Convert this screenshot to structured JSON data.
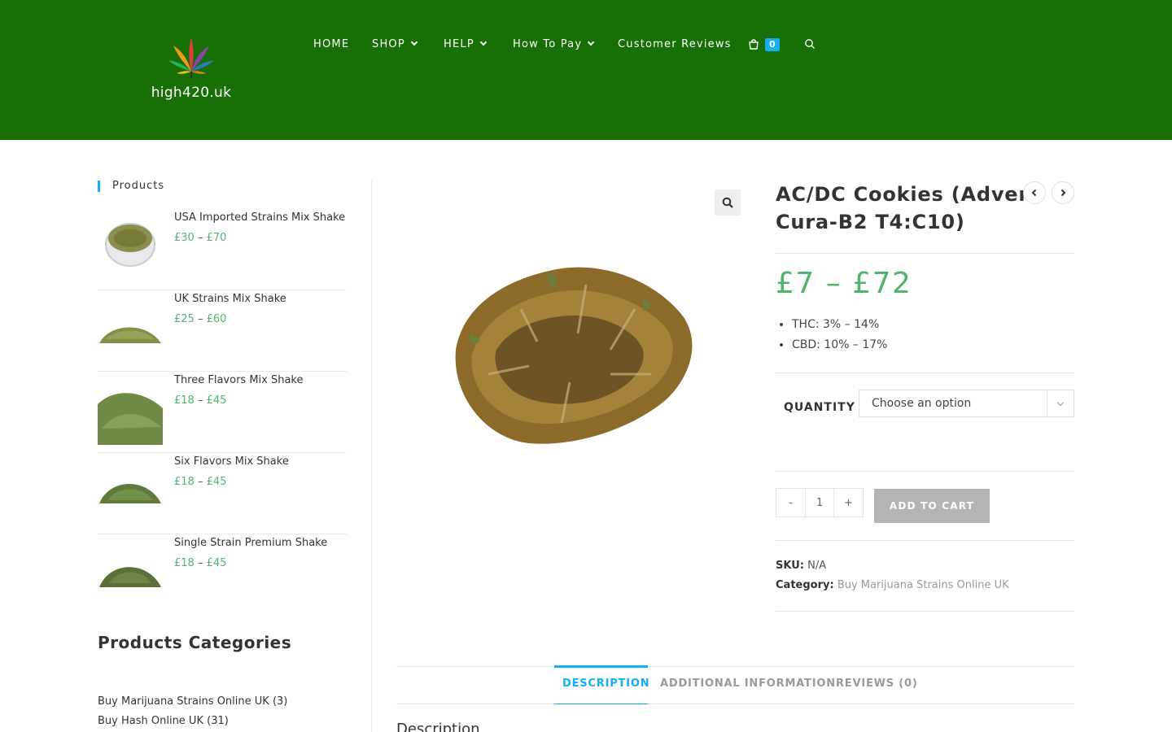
{
  "site": {
    "logo_text": "high420.uk",
    "brand_color": "#176f05",
    "accent_color": "#13aff0",
    "price_color": "#52b36e"
  },
  "nav": {
    "items": [
      {
        "label": "HOME",
        "has_dropdown": false
      },
      {
        "label": "SHOP",
        "has_dropdown": true
      },
      {
        "label": "HELP",
        "has_dropdown": true
      },
      {
        "label": "How To Pay",
        "has_dropdown": true
      },
      {
        "label": "Customer Reviews",
        "has_dropdown": false
      }
    ],
    "cart_count": "0",
    "cart_icon": "shopping-bag-icon",
    "search_icon": "search-icon"
  },
  "sidebar": {
    "products_title": "Products",
    "products": [
      {
        "name": "USA Imported Strains Mix Shake",
        "price_low": "£30",
        "price_high": "£70",
        "dash": "–"
      },
      {
        "name": "UK Strains Mix Shake",
        "price_low": "£25",
        "price_high": "£60",
        "dash": "–"
      },
      {
        "name": "Three Flavors Mix Shake",
        "price_low": "£18",
        "price_high": "£45",
        "dash": "–"
      },
      {
        "name": "Six Flavors Mix Shake",
        "price_low": "£18",
        "price_high": "£45",
        "dash": "–"
      },
      {
        "name": "Single Strain Premium Shake",
        "price_low": "£18",
        "price_high": "£45",
        "dash": "–"
      }
    ],
    "categories_title": "Products Categories",
    "categories": [
      {
        "label": "Buy Marijuana Strains Online UK",
        "count": "(3)"
      },
      {
        "label": "Buy Hash Online UK",
        "count": "(31)"
      }
    ]
  },
  "product": {
    "title_line1": "AC/DC Cookies (Advent",
    "title_line2": "Cura-B2 T4:C10)",
    "price": "£7 – £72",
    "attributes": [
      "THC: 3% – 14%",
      "CBD: 10% – 17%"
    ],
    "quantity_label": "QUANTITY",
    "select_placeholder": "Choose an option",
    "qty_minus": "-",
    "qty_value": "1",
    "qty_plus": "+",
    "add_to_cart": "ADD TO CART",
    "sku_label": "SKU:",
    "sku_value": "N/A",
    "category_label": "Category:",
    "category_value": "Buy Marijuana Strains Online UK"
  },
  "tabs": {
    "items": [
      "DESCRIPTION",
      "ADDITIONAL INFORMATION",
      "REVIEWS (0)"
    ],
    "active": "DESCRIPTION",
    "content_heading": "Description"
  }
}
